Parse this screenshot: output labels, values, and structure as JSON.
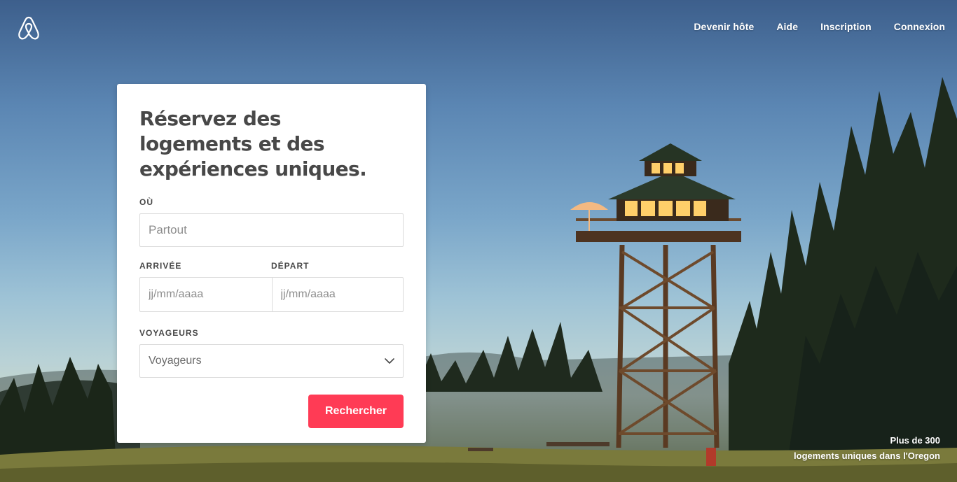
{
  "brand": {
    "logo": "airbnb-belo-logo",
    "accent": "#ff3b55"
  },
  "nav": {
    "items": [
      {
        "label": "Devenir hôte"
      },
      {
        "label": "Aide"
      },
      {
        "label": "Inscription"
      },
      {
        "label": "Connexion"
      }
    ]
  },
  "search_card": {
    "title": "Réservez des logements et des expériences uniques.",
    "where": {
      "label": "OÙ",
      "placeholder": "Partout"
    },
    "checkin": {
      "label": "ARRIVÉE",
      "placeholder": "jj/mm/aaaa"
    },
    "checkout": {
      "label": "DÉPART",
      "placeholder": "jj/mm/aaaa"
    },
    "guests": {
      "label": "VOYAGEURS",
      "value": "Voyageurs",
      "icon": "chevron-down-icon"
    },
    "submit_label": "Rechercher"
  },
  "caption": {
    "line1": "Plus de 300",
    "line2": "logements uniques dans l'Oregon"
  }
}
